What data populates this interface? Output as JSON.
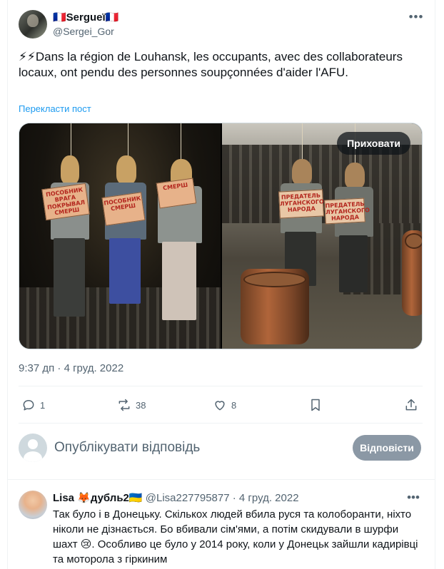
{
  "post": {
    "author_name": "🇫🇷Sergueï🇫🇷",
    "author_handle": "@Sergei_Gor",
    "more_label": "•••",
    "text": "⚡⚡Dans la région de Louhansk, les occupants, avec des collaborateurs locaux, ont pendu des personnes soupçonnées d'aider l'AFU.",
    "translate_label": "Перекласти пост",
    "hide_media_label": "Приховати",
    "timestamp": "9:37 дп · 4 груд. 2022",
    "images": [
      {
        "signs": [
          "ПОСОБНИК ВРАГА ПОКРЫВАЛ СМЕРШ",
          "ПОСОБНИК СМЕРШ",
          "СМЕРШ"
        ]
      },
      {
        "signs": [
          "ПРЕДАТЕЛЬ ЛУГАНСКОГО НАРОДА",
          "ПРЕДАТЕЛЬ ЛУГАНСКОГО НАРОДА"
        ]
      }
    ]
  },
  "actions": {
    "replies": "1",
    "reposts": "38",
    "likes": "8"
  },
  "reply_box": {
    "placeholder": "Опублікувати відповідь",
    "button_label": "Відповісти"
  },
  "comment": {
    "name": "Lisa 🦊дубль2🇺🇦",
    "handle": "@Lisa227795877",
    "separator": " · ",
    "date": "4 груд. 2022",
    "more_label": "•••",
    "text": "Так було і в Донецьку. Скількох людей вбила руся та колоборанти, ніхто ніколи не дізнається. Бо вбивали сім'ями, а потім скидували в шурфи шахт 😢. Особливо це було у 2014 року, коли у Донецьк зайшли кадирівці та моторола з гіркиним"
  },
  "colors": {
    "link": "#1d9bf0",
    "secondary_text": "#536471",
    "reply_button": "#8b98a5"
  }
}
